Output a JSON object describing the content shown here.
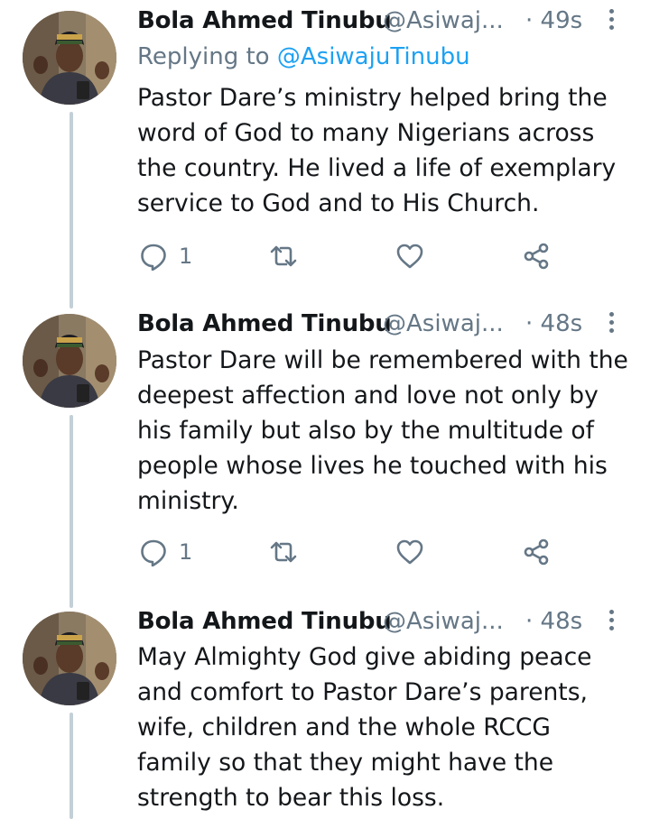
{
  "tweets": [
    {
      "author_name": "Bola Ahmed Tinubu",
      "author_handle": "@Asiwaj...",
      "time": "· 49s",
      "reply_prefix": "Replying to",
      "reply_mention": "@AsiwajuTinubu",
      "text": "Pastor Dare’s ministry helped bring the word of God to many Nigerians across the country. He lived a life of exemplary service to God and to His Church.",
      "reply_count": "1"
    },
    {
      "author_name": "Bola Ahmed Tinubu",
      "author_handle": "@Asiwaj...",
      "time": "· 48s",
      "text": "Pastor Dare will be remembered with the deepest affection and love not only by his family but also by the multitude of people whose lives he touched with his ministry.",
      "reply_count": "1"
    },
    {
      "author_name": "Bola Ahmed Tinubu",
      "author_handle": "@Asiwaj...",
      "time": "· 48s",
      "text": "May Almighty God give abiding peace and comfort to Pastor Dare’s parents, wife, children and the whole RCCG family so that they might have the strength to bear this loss."
    }
  ],
  "icons": {
    "reply": "reply-icon",
    "retweet": "retweet-icon",
    "like": "heart-icon",
    "share": "share-icon",
    "more": "more-vertical-icon"
  },
  "colors": {
    "text": "#14171a",
    "secondary": "#657786",
    "link": "#1da1f2",
    "thread_line": "#c4cfd6"
  }
}
